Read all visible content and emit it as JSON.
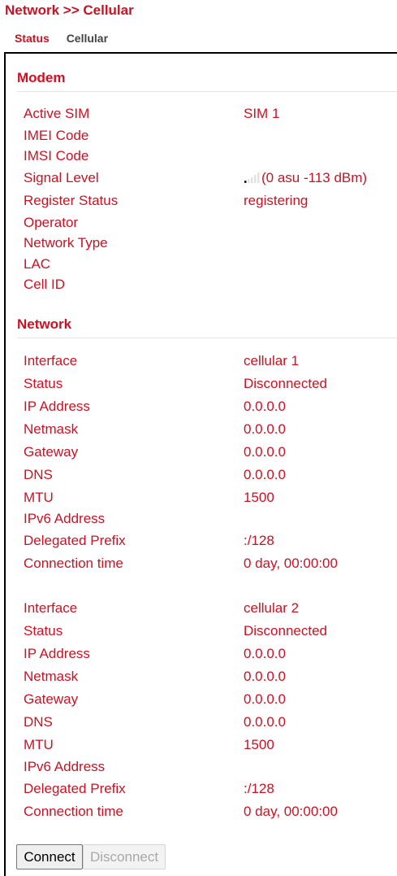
{
  "breadcrumb": "Network >> Cellular",
  "tabs": {
    "status": "Status",
    "cellular": "Cellular"
  },
  "modem": {
    "title": "Modem",
    "active_sim": {
      "label": "Active SIM",
      "value": "SIM 1"
    },
    "imei": {
      "label": "IMEI Code",
      "value": ""
    },
    "imsi": {
      "label": "IMSI Code",
      "value": ""
    },
    "signal": {
      "label": "Signal Level",
      "value": "(0 asu -113 dBm)",
      "bars": 0
    },
    "register_status": {
      "label": "Register Status",
      "value": "registering"
    },
    "operator": {
      "label": "Operator",
      "value": ""
    },
    "network_type": {
      "label": "Network Type",
      "value": ""
    },
    "lac": {
      "label": "LAC",
      "value": ""
    },
    "cell_id": {
      "label": "Cell ID",
      "value": ""
    }
  },
  "network": {
    "title": "Network",
    "interfaces": [
      {
        "interface": {
          "label": "Interface",
          "value": "cellular 1"
        },
        "status": {
          "label": "Status",
          "value": "Disconnected"
        },
        "ip": {
          "label": "IP Address",
          "value": "0.0.0.0"
        },
        "netmask": {
          "label": "Netmask",
          "value": "0.0.0.0"
        },
        "gateway": {
          "label": "Gateway",
          "value": "0.0.0.0"
        },
        "dns": {
          "label": "DNS",
          "value": "0.0.0.0"
        },
        "mtu": {
          "label": "MTU",
          "value": "1500"
        },
        "ipv6": {
          "label": "IPv6 Address",
          "value": ""
        },
        "prefix": {
          "label": "Delegated Prefix",
          "value": ":/128"
        },
        "conn_time": {
          "label": "Connection time",
          "value": "0 day, 00:00:00"
        }
      },
      {
        "interface": {
          "label": "Interface",
          "value": "cellular 2"
        },
        "status": {
          "label": "Status",
          "value": "Disconnected"
        },
        "ip": {
          "label": "IP Address",
          "value": "0.0.0.0"
        },
        "netmask": {
          "label": "Netmask",
          "value": "0.0.0.0"
        },
        "gateway": {
          "label": "Gateway",
          "value": "0.0.0.0"
        },
        "dns": {
          "label": "DNS",
          "value": "0.0.0.0"
        },
        "mtu": {
          "label": "MTU",
          "value": "1500"
        },
        "ipv6": {
          "label": "IPv6 Address",
          "value": ""
        },
        "prefix": {
          "label": "Delegated Prefix",
          "value": ":/128"
        },
        "conn_time": {
          "label": "Connection time",
          "value": "0 day, 00:00:00"
        }
      }
    ]
  },
  "buttons": {
    "connect": "Connect",
    "disconnect": "Disconnect"
  },
  "colors": {
    "accent": "#cc1122"
  }
}
